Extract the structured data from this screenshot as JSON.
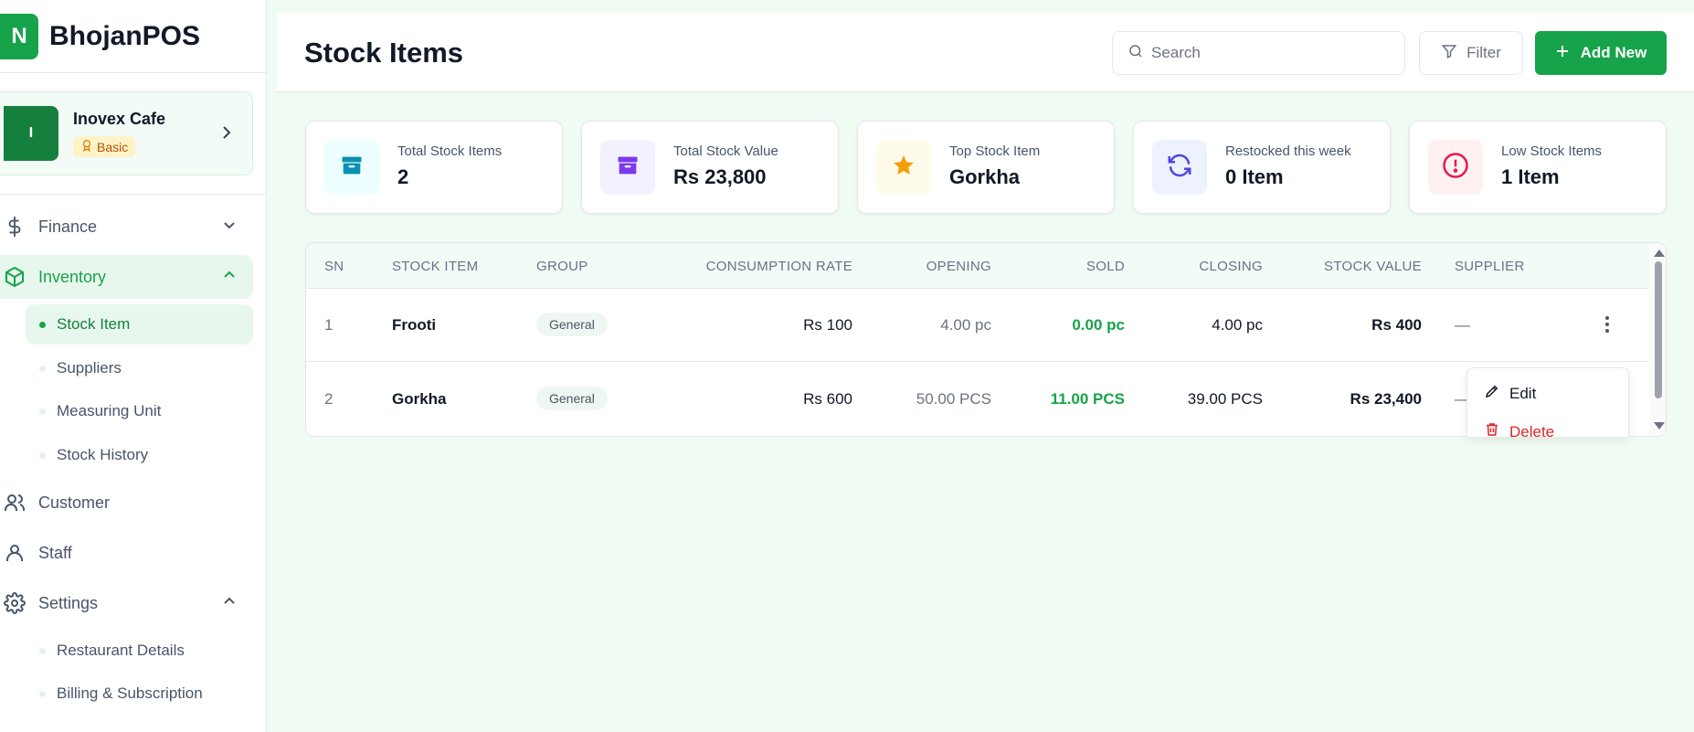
{
  "brand": {
    "logo_letter": "N",
    "name": "BhojanPOS"
  },
  "cafe": {
    "avatar_letter": "I",
    "name": "Inovex Cafe",
    "plan": "Basic"
  },
  "nav": {
    "finance": "Finance",
    "inventory": "Inventory",
    "inventory_sub": [
      "Stock Item",
      "Suppliers",
      "Measuring Unit",
      "Stock History"
    ],
    "customer": "Customer",
    "staff": "Staff",
    "settings": "Settings",
    "settings_sub": [
      "Restaurant Details",
      "Billing & Subscription"
    ]
  },
  "header": {
    "title": "Stock Items",
    "search_placeholder": "Search",
    "filter_label": "Filter",
    "add_label": "Add New"
  },
  "stats": [
    {
      "label": "Total Stock Items",
      "value": "2",
      "icon": "archive-icon",
      "color": "#0891b2",
      "bg": "#ecfeff"
    },
    {
      "label": "Total Stock Value",
      "value": "Rs 23,800",
      "icon": "archive-icon",
      "color": "#7c3aed",
      "bg": "#f3f0ff"
    },
    {
      "label": "Top Stock Item",
      "value": "Gorkha",
      "icon": "star-icon",
      "color": "#f59e0b",
      "bg": "#fffbeb"
    },
    {
      "label": "Restocked this week",
      "value": "0 Item",
      "icon": "refresh-icon",
      "color": "#4f46e5",
      "bg": "#eef2ff"
    },
    {
      "label": "Low Stock Items",
      "value": "1 Item",
      "icon": "alert-circle-icon",
      "color": "#e11d48",
      "bg": "#fff1f2"
    }
  ],
  "table": {
    "columns": [
      "SN",
      "STOCK ITEM",
      "GROUP",
      "CONSUMPTION RATE",
      "OPENING",
      "SOLD",
      "CLOSING",
      "STOCK VALUE",
      "SUPPLIER"
    ],
    "rows": [
      {
        "sn": "1",
        "item": "Frooti",
        "group": "General",
        "rate": "Rs 100",
        "opening": "4.00 pc",
        "sold": "0.00 pc",
        "closing": "4.00 pc",
        "value": "Rs 400",
        "supplier": "—"
      },
      {
        "sn": "2",
        "item": "Gorkha",
        "group": "General",
        "rate": "Rs 600",
        "opening": "50.00 PCS",
        "sold": "11.00 PCS",
        "closing": "39.00 PCS",
        "value": "Rs 23,400",
        "supplier": "—"
      }
    ]
  },
  "row_menu": {
    "edit": "Edit",
    "delete": "Delete"
  },
  "colors": {
    "brand": "#16a34a",
    "danger": "#dc2626"
  }
}
